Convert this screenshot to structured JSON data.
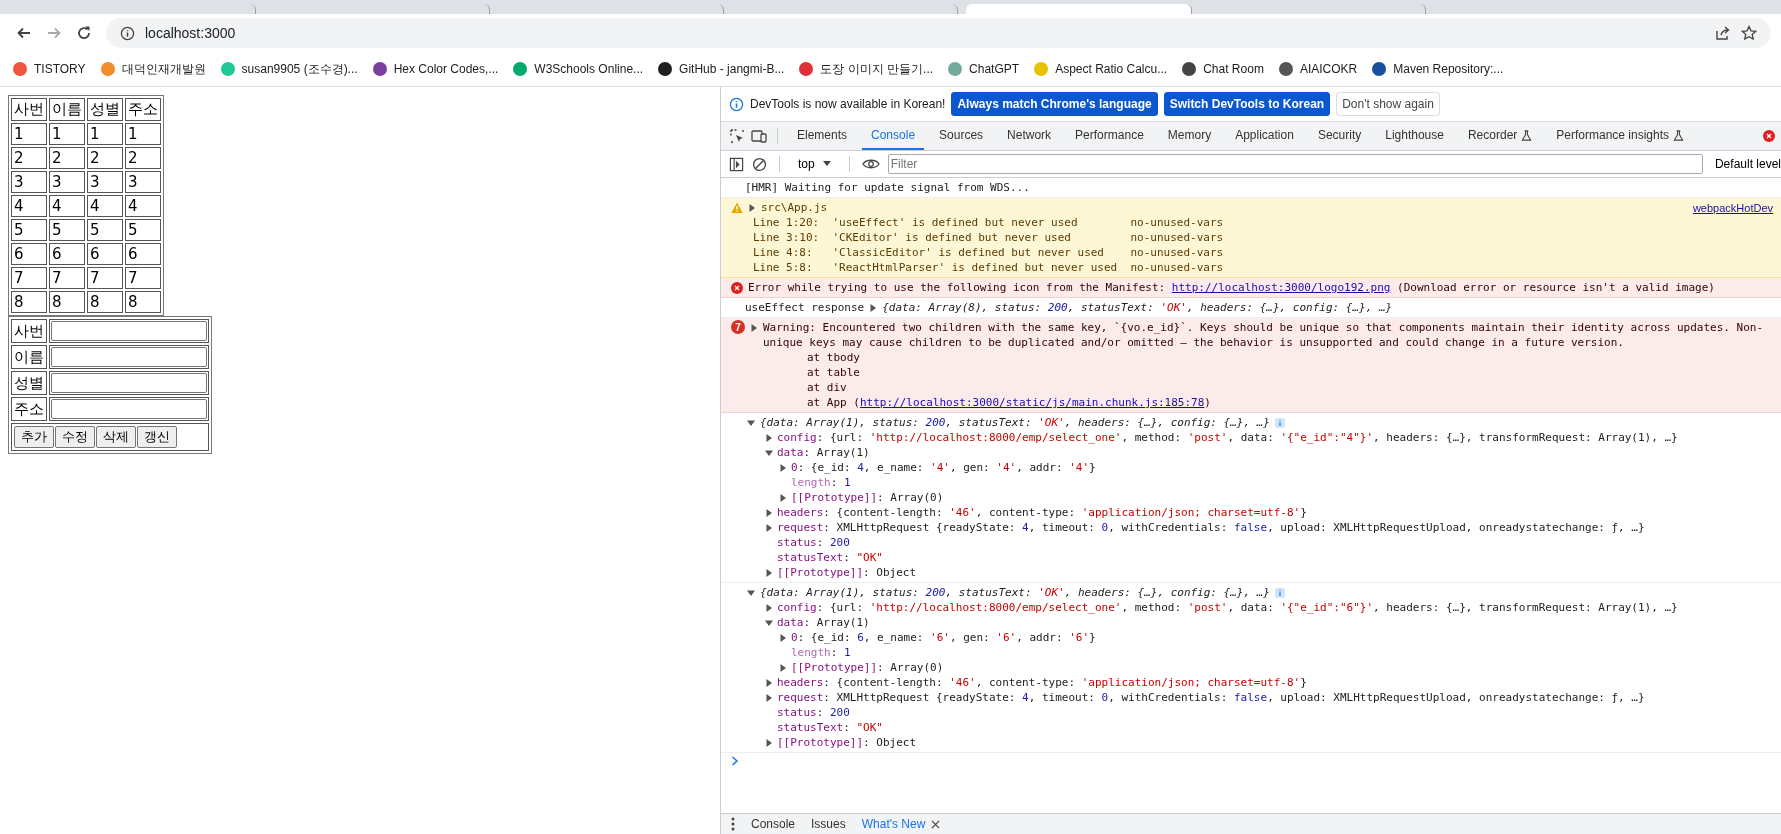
{
  "browser": {
    "tabs": [
      {
        "selected": false
      },
      {
        "selected": false
      },
      {
        "selected": false
      },
      {
        "selected": false
      },
      {
        "selected": true
      },
      {
        "selected": false
      }
    ],
    "address": "localhost:3000",
    "bookmarks": [
      {
        "label": "TISTORY",
        "color": "#f0553e"
      },
      {
        "label": "대덕인재개발원",
        "color": "#f28c28"
      },
      {
        "label": "susan9905 (조수경)...",
        "color": "#20c997"
      },
      {
        "label": "Hex Color Codes,...",
        "color": "#7b3fa0"
      },
      {
        "label": "W3Schools Online...",
        "color": "#04aa6d"
      },
      {
        "label": "GitHub - jangmi-B...",
        "color": "#1f1f1f"
      },
      {
        "label": "도장 이미지 만들기...",
        "color": "#e0313b"
      },
      {
        "label": "ChatGPT",
        "color": "#74aa9c"
      },
      {
        "label": "Aspect Ratio Calcu...",
        "color": "#e8c200"
      },
      {
        "label": "Chat Room",
        "color": "#444444"
      },
      {
        "label": "AIAICOKR",
        "color": "#555555"
      },
      {
        "label": "Maven Repository:...",
        "color": "#1a4fa0"
      }
    ]
  },
  "page": {
    "table": {
      "columns": [
        "사번",
        "이름",
        "성별",
        "주소"
      ],
      "rows": [
        [
          "1",
          "1",
          "1",
          "1"
        ],
        [
          "2",
          "2",
          "2",
          "2"
        ],
        [
          "3",
          "3",
          "3",
          "3"
        ],
        [
          "4",
          "4",
          "4",
          "4"
        ],
        [
          "5",
          "5",
          "5",
          "5"
        ],
        [
          "6",
          "6",
          "6",
          "6"
        ],
        [
          "7",
          "7",
          "7",
          "7"
        ],
        [
          "8",
          "8",
          "8",
          "8"
        ]
      ]
    },
    "form": {
      "fields": [
        {
          "label": "사번"
        },
        {
          "label": "이름"
        },
        {
          "label": "성별"
        },
        {
          "label": "주소"
        }
      ],
      "buttons": [
        "추가",
        "수정",
        "삭제",
        "갱신"
      ]
    }
  },
  "devtools": {
    "infobar": {
      "text": "DevTools is now available in Korean!",
      "buttons": [
        {
          "label": "Always match Chrome's language",
          "kind": "primary"
        },
        {
          "label": "Switch DevTools to Korean",
          "kind": "primary"
        },
        {
          "label": "Don't show again",
          "kind": "secondary"
        }
      ]
    },
    "tabs": [
      {
        "label": "Elements",
        "selected": false,
        "experimental": false
      },
      {
        "label": "Console",
        "selected": true,
        "experimental": false
      },
      {
        "label": "Sources",
        "selected": false,
        "experimental": false
      },
      {
        "label": "Network",
        "selected": false,
        "experimental": false
      },
      {
        "label": "Performance",
        "selected": false,
        "experimental": false
      },
      {
        "label": "Memory",
        "selected": false,
        "experimental": false
      },
      {
        "label": "Application",
        "selected": false,
        "experimental": false
      },
      {
        "label": "Security",
        "selected": false,
        "experimental": false
      },
      {
        "label": "Lighthouse",
        "selected": false,
        "experimental": false
      },
      {
        "label": "Recorder",
        "selected": false,
        "experimental": true
      },
      {
        "label": "Performance insights",
        "selected": false,
        "experimental": true
      }
    ],
    "toolbar": {
      "context": "top",
      "filter_placeholder": "Filter",
      "levels": "Default level"
    },
    "messages": [
      {
        "kind": "log",
        "text": "[HMR] Waiting for update signal from WDS..."
      },
      {
        "kind": "warning",
        "title": "src\\App.js",
        "source": "webpackHotDev",
        "expanded": false,
        "lines": [
          "Line 1:20:  'useEffect' is defined but never used        no-unused-vars",
          "Line 3:10:  'CKEditor' is defined but never used         no-unused-vars",
          "Line 4:8:   'ClassicEditor' is defined but never used    no-unused-vars",
          "Line 5:8:   'ReactHtmlParser' is defined but never used  no-unused-vars"
        ]
      },
      {
        "kind": "error",
        "text": "Error while trying to use the following icon from the Manifest: ",
        "link": "http://localhost:3000/logo192.png",
        "after": " (Download error or resource isn't a valid image)"
      },
      {
        "kind": "log_object",
        "text": "useEffect response",
        "expanded": false,
        "preview": [
          {
            "text": "{data: Array(8), status: ",
            "kind": "plain"
          },
          {
            "text": "200",
            "kind": "num"
          },
          {
            "text": ", statusText: ",
            "kind": "plain"
          },
          {
            "text": "'OK'",
            "kind": "str"
          },
          {
            "text": ", headers: {…}, config: {…}, …}",
            "kind": "plain"
          }
        ]
      },
      {
        "kind": "error_group",
        "count": "7",
        "expanded": false,
        "text": "Warning: Encountered two children with the same key, `{vo.e_id}`. Keys should be unique so that components maintain their identity across updates. Non-unique keys may cause children to be duplicated and/or omitted — the behavior is unsupported and could change in a future version.",
        "stack": [
          "at tbody",
          "at table",
          "at div"
        ],
        "stack_last": "at App (",
        "link": "http://localhost:3000/static/js/main.chunk.js:185:78",
        "stack_end": ")"
      },
      {
        "kind": "object",
        "expanded": true,
        "preview": [
          {
            "text": "{data: Array(1), status: ",
            "kind": "plain"
          },
          {
            "text": "200",
            "kind": "num"
          },
          {
            "text": ", statusText: ",
            "kind": "plain"
          },
          {
            "text": "'OK'",
            "kind": "str"
          },
          {
            "text": ", headers: {…}, config: {…}, …}",
            "kind": "plain"
          }
        ],
        "children": [
          {
            "expanded": false,
            "tokens": [
              {
                "text": "config",
                "kind": "key"
              },
              {
                "text": ": {url: ",
                "kind": "plain"
              },
              {
                "text": "'http://localhost:8000/emp/select_one'",
                "kind": "str"
              },
              {
                "text": ", method: ",
                "kind": "plain"
              },
              {
                "text": "'post'",
                "kind": "str"
              },
              {
                "text": ", data: ",
                "kind": "plain"
              },
              {
                "text": "'{\"e_id\":\"4\"}'",
                "kind": "str"
              },
              {
                "text": ", headers: {…}, transformRequest: Array(1), …}",
                "kind": "plain"
              }
            ]
          },
          {
            "expanded": true,
            "tokens": [
              {
                "text": "data",
                "kind": "key"
              },
              {
                "text": ": Array(1)",
                "kind": "plain"
              }
            ],
            "children": [
              {
                "expanded": false,
                "tokens": [
                  {
                    "text": "0",
                    "kind": "key"
                  },
                  {
                    "text": ": {e_id: ",
                    "kind": "plain"
                  },
                  {
                    "text": "4",
                    "kind": "num"
                  },
                  {
                    "text": ", e_name: ",
                    "kind": "plain"
                  },
                  {
                    "text": "'4'",
                    "kind": "str"
                  },
                  {
                    "text": ", gen: ",
                    "kind": "plain"
                  },
                  {
                    "text": "'4'",
                    "kind": "str"
                  },
                  {
                    "text": ", addr: ",
                    "kind": "plain"
                  },
                  {
                    "text": "'4'",
                    "kind": "str"
                  },
                  {
                    "text": "}",
                    "kind": "plain"
                  }
                ]
              },
              {
                "tokens": [
                  {
                    "text": "length",
                    "kind": "faded_key"
                  },
                  {
                    "text": ": ",
                    "kind": "plain"
                  },
                  {
                    "text": "1",
                    "kind": "num"
                  }
                ]
              },
              {
                "expanded": false,
                "tokens": [
                  {
                    "text": "[[Prototype]]",
                    "kind": "key"
                  },
                  {
                    "text": ": Array(0)",
                    "kind": "plain"
                  }
                ]
              }
            ]
          },
          {
            "expanded": false,
            "tokens": [
              {
                "text": "headers",
                "kind": "key"
              },
              {
                "text": ": {content-length: ",
                "kind": "plain"
              },
              {
                "text": "'46'",
                "kind": "str"
              },
              {
                "text": ", content-type: ",
                "kind": "plain"
              },
              {
                "text": "'application/json; charset=utf-8'",
                "kind": "str"
              },
              {
                "text": "}",
                "kind": "plain"
              }
            ]
          },
          {
            "expanded": false,
            "tokens": [
              {
                "text": "request",
                "kind": "key"
              },
              {
                "text": ": XMLHttpRequest {readyState: ",
                "kind": "plain"
              },
              {
                "text": "4",
                "kind": "num"
              },
              {
                "text": ", timeout: ",
                "kind": "plain"
              },
              {
                "text": "0",
                "kind": "num"
              },
              {
                "text": ", withCredentials: ",
                "kind": "plain"
              },
              {
                "text": "false",
                "kind": "num"
              },
              {
                "text": ", upload: XMLHttpRequestUpload, onreadystatechange: ƒ, …}",
                "kind": "plain"
              }
            ]
          },
          {
            "tokens": [
              {
                "text": "status",
                "kind": "key"
              },
              {
                "text": ": ",
                "kind": "plain"
              },
              {
                "text": "200",
                "kind": "num"
              }
            ]
          },
          {
            "tokens": [
              {
                "text": "statusText",
                "kind": "key"
              },
              {
                "text": ": ",
                "kind": "plain"
              },
              {
                "text": "\"OK\"",
                "kind": "str"
              }
            ]
          },
          {
            "expanded": false,
            "tokens": [
              {
                "text": "[[Prototype]]",
                "kind": "key"
              },
              {
                "text": ": Object",
                "kind": "plain"
              }
            ]
          }
        ]
      },
      {
        "kind": "object",
        "expanded": true,
        "preview": [
          {
            "text": "{data: Array(1), status: ",
            "kind": "plain"
          },
          {
            "text": "200",
            "kind": "num"
          },
          {
            "text": ", statusText: ",
            "kind": "plain"
          },
          {
            "text": "'OK'",
            "kind": "str"
          },
          {
            "text": ", headers: {…}, config: {…}, …}",
            "kind": "plain"
          }
        ],
        "children": [
          {
            "expanded": false,
            "tokens": [
              {
                "text": "config",
                "kind": "key"
              },
              {
                "text": ": {url: ",
                "kind": "plain"
              },
              {
                "text": "'http://localhost:8000/emp/select_one'",
                "kind": "str"
              },
              {
                "text": ", method: ",
                "kind": "plain"
              },
              {
                "text": "'post'",
                "kind": "str"
              },
              {
                "text": ", data: ",
                "kind": "plain"
              },
              {
                "text": "'{\"e_id\":\"6\"}'",
                "kind": "str"
              },
              {
                "text": ", headers: {…}, transformRequest: Array(1), …}",
                "kind": "plain"
              }
            ]
          },
          {
            "expanded": true,
            "tokens": [
              {
                "text": "data",
                "kind": "key"
              },
              {
                "text": ": Array(1)",
                "kind": "plain"
              }
            ],
            "children": [
              {
                "expanded": false,
                "tokens": [
                  {
                    "text": "0",
                    "kind": "key"
                  },
                  {
                    "text": ": {e_id: ",
                    "kind": "plain"
                  },
                  {
                    "text": "6",
                    "kind": "num"
                  },
                  {
                    "text": ", e_name: ",
                    "kind": "plain"
                  },
                  {
                    "text": "'6'",
                    "kind": "str"
                  },
                  {
                    "text": ", gen: ",
                    "kind": "plain"
                  },
                  {
                    "text": "'6'",
                    "kind": "str"
                  },
                  {
                    "text": ", addr: ",
                    "kind": "plain"
                  },
                  {
                    "text": "'6'",
                    "kind": "str"
                  },
                  {
                    "text": "}",
                    "kind": "plain"
                  }
                ]
              },
              {
                "tokens": [
                  {
                    "text": "length",
                    "kind": "faded_key"
                  },
                  {
                    "text": ": ",
                    "kind": "plain"
                  },
                  {
                    "text": "1",
                    "kind": "num"
                  }
                ]
              },
              {
                "expanded": false,
                "tokens": [
                  {
                    "text": "[[Prototype]]",
                    "kind": "key"
                  },
                  {
                    "text": ": Array(0)",
                    "kind": "plain"
                  }
                ]
              }
            ]
          },
          {
            "expanded": false,
            "tokens": [
              {
                "text": "headers",
                "kind": "key"
              },
              {
                "text": ": {content-length: ",
                "kind": "plain"
              },
              {
                "text": "'46'",
                "kind": "str"
              },
              {
                "text": ", content-type: ",
                "kind": "plain"
              },
              {
                "text": "'application/json; charset=utf-8'",
                "kind": "str"
              },
              {
                "text": "}",
                "kind": "plain"
              }
            ]
          },
          {
            "expanded": false,
            "tokens": [
              {
                "text": "request",
                "kind": "key"
              },
              {
                "text": ": XMLHttpRequest {readyState: ",
                "kind": "plain"
              },
              {
                "text": "4",
                "kind": "num"
              },
              {
                "text": ", timeout: ",
                "kind": "plain"
              },
              {
                "text": "0",
                "kind": "num"
              },
              {
                "text": ", withCredentials: ",
                "kind": "plain"
              },
              {
                "text": "false",
                "kind": "num"
              },
              {
                "text": ", upload: XMLHttpRequestUpload, onreadystatechange: ƒ, …}",
                "kind": "plain"
              }
            ]
          },
          {
            "tokens": [
              {
                "text": "status",
                "kind": "key"
              },
              {
                "text": ": ",
                "kind": "plain"
              },
              {
                "text": "200",
                "kind": "num"
              }
            ]
          },
          {
            "tokens": [
              {
                "text": "statusText",
                "kind": "key"
              },
              {
                "text": ": ",
                "kind": "plain"
              },
              {
                "text": "\"OK\"",
                "kind": "str"
              }
            ]
          },
          {
            "expanded": false,
            "tokens": [
              {
                "text": "[[Prototype]]",
                "kind": "key"
              },
              {
                "text": ": Object",
                "kind": "plain"
              }
            ]
          }
        ]
      }
    ],
    "drawer_tabs": [
      {
        "label": "Console",
        "selected": false,
        "closable": false
      },
      {
        "label": "Issues",
        "selected": false,
        "closable": false
      },
      {
        "label": "What's New",
        "selected": true,
        "closable": true
      }
    ]
  }
}
